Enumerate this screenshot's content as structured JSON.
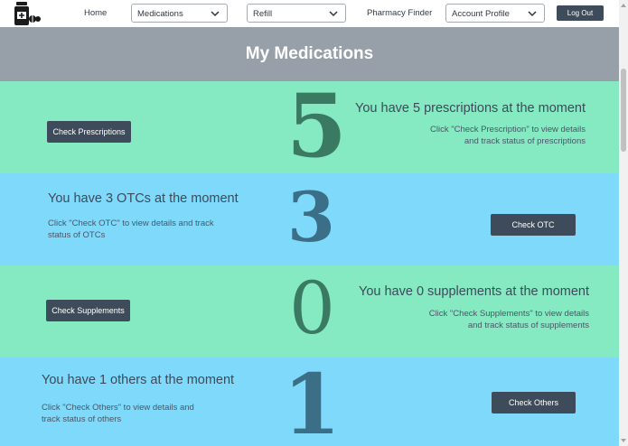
{
  "nav": {
    "home": "Home",
    "medications_select": "Medications",
    "refill_select": "Refill",
    "pharmacy_finder": "Pharmacy Finder",
    "account_select": "Account Profile",
    "logout": "Log Out"
  },
  "page": {
    "title": "My Medications"
  },
  "sections": [
    {
      "count": "5",
      "headline": "You have 5 prescriptions at the moment",
      "desc_line1": "Click \"Check Prescription\" to view details",
      "desc_line2": "and track status of  prescriptions",
      "button": "Check Prescriptions",
      "background": "#85e9c2",
      "number_color": "#3a7a62"
    },
    {
      "count": "3",
      "headline": "You have 3 OTCs at the moment",
      "desc_line1": "Click \"Check OTC\" to view details and track",
      "desc_line2": "status of OTCs",
      "button": "Check OTC",
      "background": "#7fd9fa",
      "number_color": "#3b6f87"
    },
    {
      "count": "0",
      "headline": "You have 0 supplements at the moment",
      "desc_line1": "Click \"Check Supplements\" to view details",
      "desc_line2": "and track status of supplements",
      "button": "Check Supplements",
      "background": "#85e9c2",
      "number_color": "#3a7a62"
    },
    {
      "count": "1",
      "headline": "You have 1 others at the moment",
      "desc_line1": "Click \"Check Others\" to view details and",
      "desc_line2": "track status of others",
      "button": "Check Others",
      "background": "#7fd9fa",
      "number_color": "#3b6f87"
    }
  ],
  "colors": {
    "button": "#3e4b5b",
    "header": "#97a0a9",
    "text": "#3d4a5a"
  },
  "icons": {
    "logo": "medicine-bottle-pills-icon",
    "select_arrow": "chevron-down-icon"
  }
}
